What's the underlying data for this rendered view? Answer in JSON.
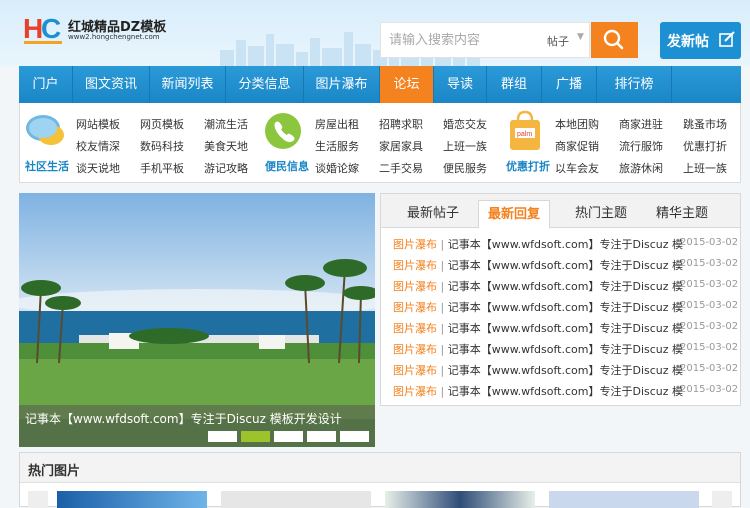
{
  "brand": {
    "logo_text": "HC",
    "title": "红城精品DZ模板",
    "subtitle": "www2.hongchengnet.com"
  },
  "search": {
    "placeholder": "请输入搜索内容",
    "scope": "帖子",
    "post_button": "发新帖"
  },
  "nav": {
    "items": [
      {
        "label": "门户",
        "active": false
      },
      {
        "label": "图文资讯",
        "active": false
      },
      {
        "label": "新闻列表",
        "active": false
      },
      {
        "label": "分类信息",
        "active": false
      },
      {
        "label": "图片瀑布",
        "active": false
      },
      {
        "label": "论坛",
        "active": true
      },
      {
        "label": "导读",
        "active": false
      },
      {
        "label": "群组",
        "active": false
      },
      {
        "label": "广播",
        "active": false
      },
      {
        "label": "排行榜",
        "active": false
      }
    ]
  },
  "categories": [
    {
      "name": "社区生活",
      "icon": "speech-bubbles-icon",
      "color": "#1a86c7",
      "links": [
        "网站模板",
        "网页模板",
        "潮流生活",
        "校友情深",
        "数码科技",
        "美食天地",
        "谈天说地",
        "手机平板",
        "游记攻略"
      ]
    },
    {
      "name": "便民信息",
      "icon": "phone-icon",
      "color": "#1a86c7",
      "links": [
        "房屋出租",
        "招聘求职",
        "婚恋交友",
        "生活服务",
        "家居家具",
        "上班一族",
        "谈婚论嫁",
        "二手交易",
        "便民服务"
      ]
    },
    {
      "name": "优惠打折",
      "icon": "shopping-bag-icon",
      "color": "#1a86c7",
      "links": [
        "本地团购",
        "商家进驻",
        "跳蚤市场",
        "商家促销",
        "流行服饰",
        "优惠打折",
        "以车会友",
        "旅游休闲",
        "上班一族"
      ]
    }
  ],
  "slider": {
    "caption": "记事本【www.wfdsoft.com】专注于Discuz 模板开发设计",
    "active_index": 1,
    "slide_count": 5
  },
  "tabs": [
    "最新帖子",
    "最新回复",
    "热门主题",
    "精华主题"
  ],
  "active_tab": 1,
  "posts": [
    {
      "category": "图片瀑布",
      "title": "记事本【www.wfdsoft.com】专注于Discuz 模",
      "date": "2015-03-02"
    },
    {
      "category": "图片瀑布",
      "title": "记事本【www.wfdsoft.com】专注于Discuz 模",
      "date": "2015-03-02"
    },
    {
      "category": "图片瀑布",
      "title": "记事本【www.wfdsoft.com】专注于Discuz 模",
      "date": "2015-03-02"
    },
    {
      "category": "图片瀑布",
      "title": "记事本【www.wfdsoft.com】专注于Discuz 模",
      "date": "2015-03-02"
    },
    {
      "category": "图片瀑布",
      "title": "记事本【www.wfdsoft.com】专注于Discuz 模",
      "date": "2015-03-02"
    },
    {
      "category": "图片瀑布",
      "title": "记事本【www.wfdsoft.com】专注于Discuz 模",
      "date": "2015-03-02"
    },
    {
      "category": "图片瀑布",
      "title": "记事本【www.wfdsoft.com】专注于Discuz 模",
      "date": "2015-03-02"
    },
    {
      "category": "图片瀑布",
      "title": "记事本【www.wfdsoft.com】专注于Discuz 模",
      "date": "2015-03-02"
    }
  ],
  "hot_images": {
    "title": "热门图片"
  },
  "colors": {
    "accent": "#f4821f",
    "nav": "#1a86c7",
    "active_dot": "#9cc22c"
  }
}
